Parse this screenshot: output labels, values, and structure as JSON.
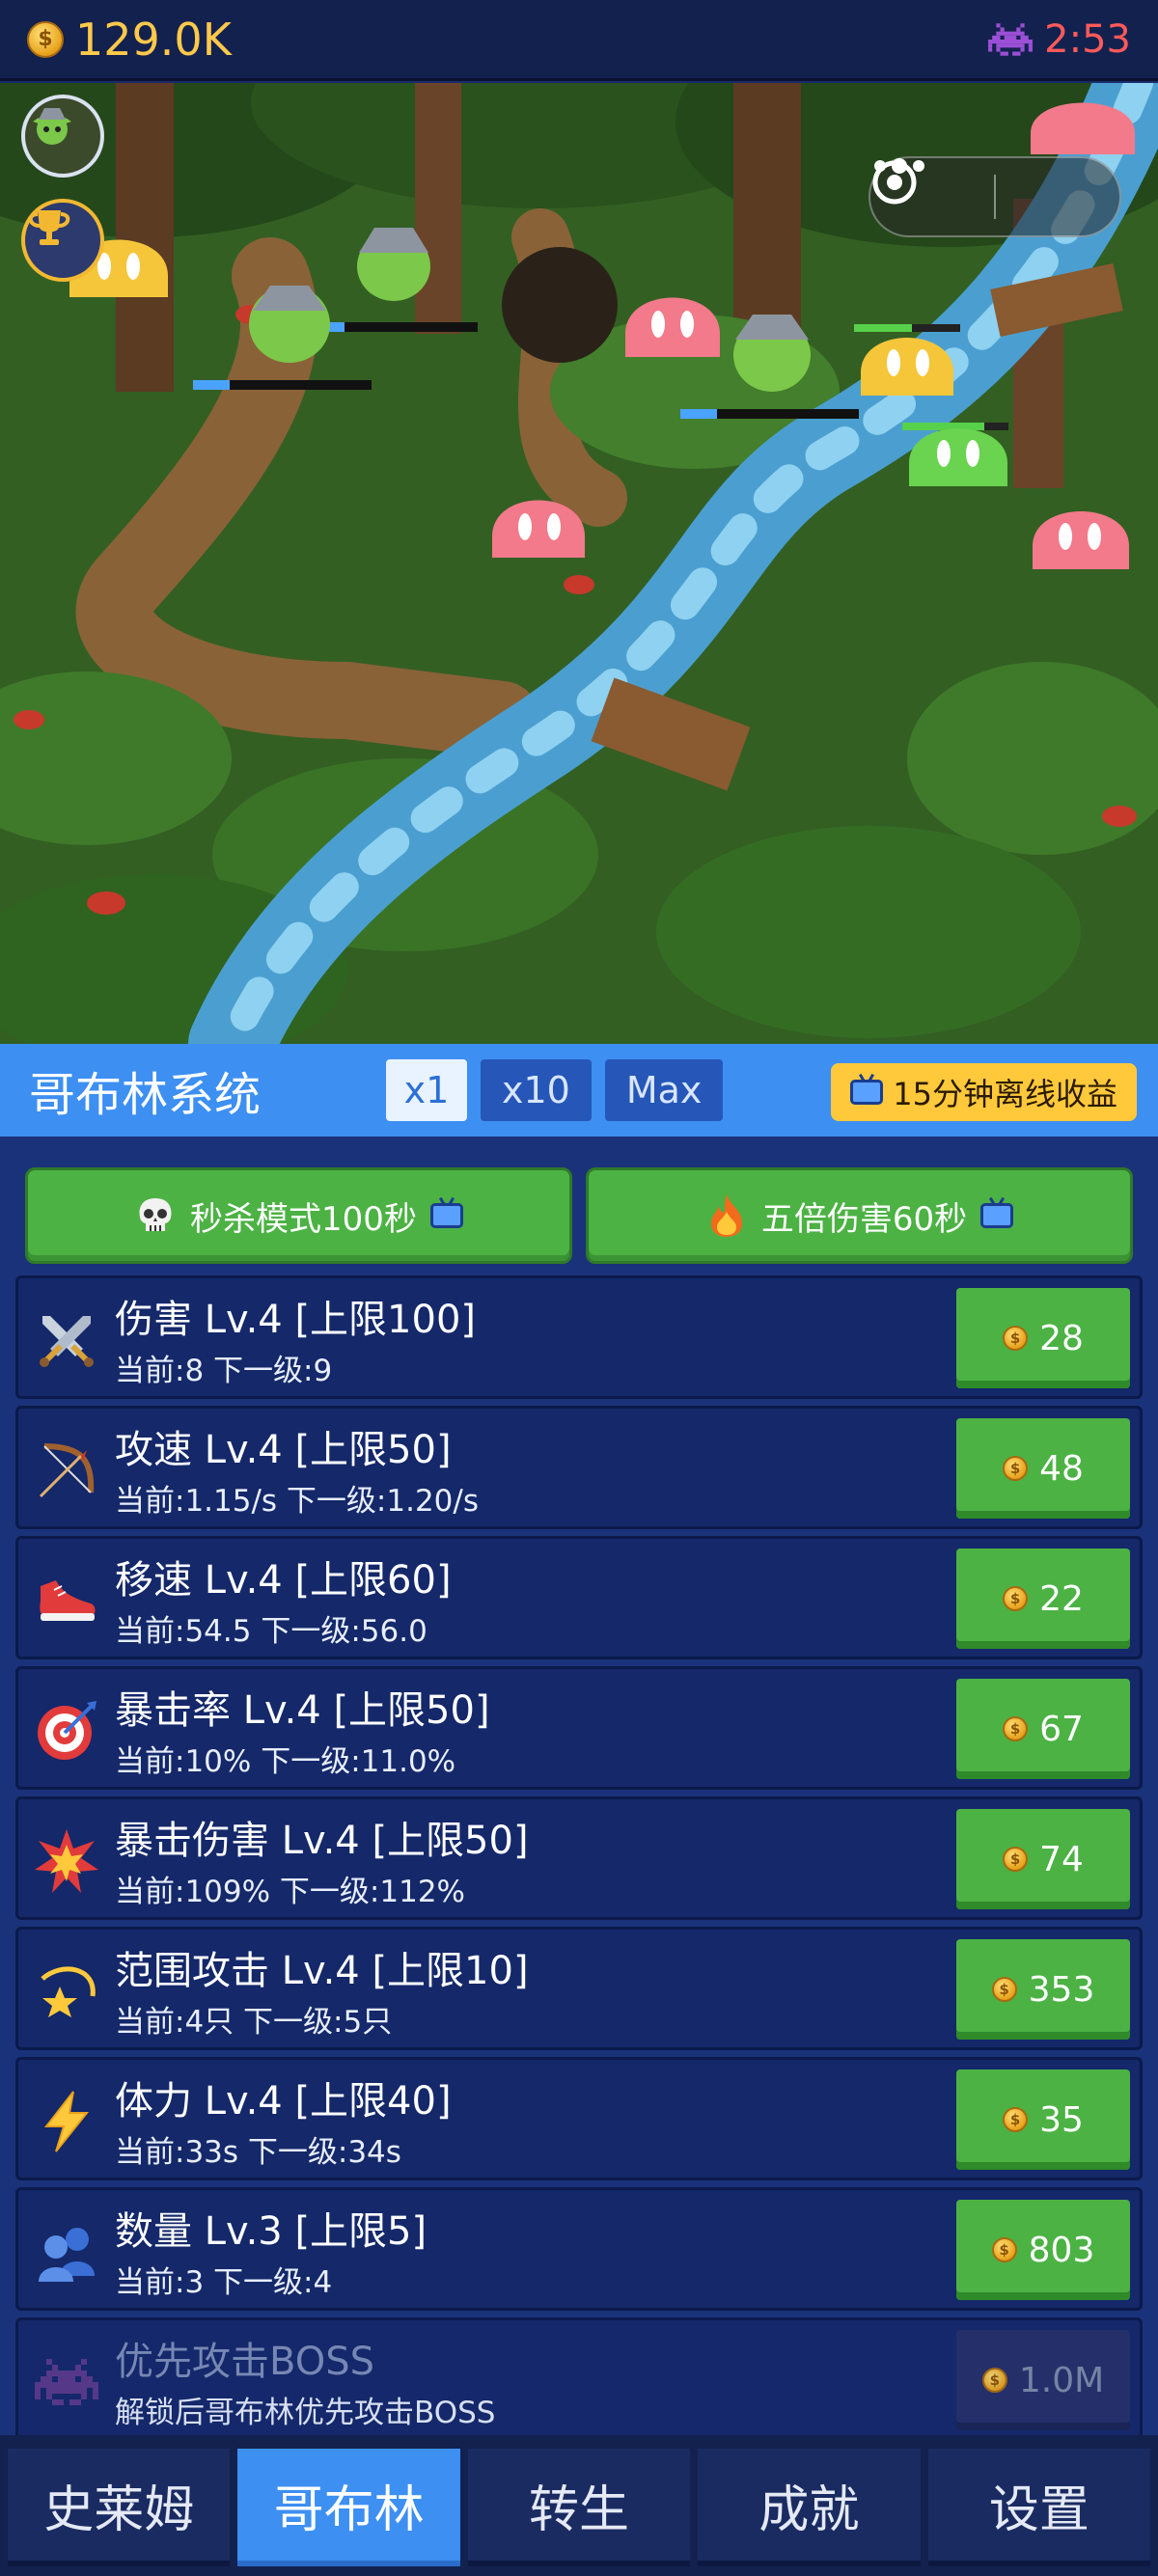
{
  "topbar": {
    "coin_symbol": "$",
    "gold": "129.0K",
    "timer": "2:53",
    "timer_color": "#ff5a5a",
    "gold_color": "#ffc94a"
  },
  "scene": {
    "capsule_icons": [
      "more-dots-icon",
      "target-circle-icon"
    ]
  },
  "system": {
    "title": "哥布林系统",
    "multipliers": [
      "x1",
      "x10",
      "Max"
    ],
    "active_multiplier": "x1",
    "offline_label": "15分钟离线收益"
  },
  "boosts": [
    {
      "label": "秒杀模式100秒",
      "icon": "skull-icon"
    },
    {
      "label": "五倍伤害60秒",
      "icon": "fire-icon"
    }
  ],
  "upgrades": [
    {
      "icon": "sword-icon",
      "title": "伤害 Lv.4 [上限100]",
      "sub": "当前:8   下一级:9",
      "cost": "28"
    },
    {
      "icon": "bow-icon",
      "title": "攻速 Lv.4 [上限50]",
      "sub": "当前:1.15/s   下一级:1.20/s",
      "cost": "48"
    },
    {
      "icon": "shoe-icon",
      "title": "移速 Lv.4 [上限60]",
      "sub": "当前:54.5   下一级:56.0",
      "cost": "22"
    },
    {
      "icon": "target-icon",
      "title": "暴击率 Lv.4 [上限50]",
      "sub": "当前:10%   下一级:11.0%",
      "cost": "67"
    },
    {
      "icon": "burst-icon",
      "title": "暴击伤害 Lv.4 [上限50]",
      "sub": "当前:109%   下一级:112%",
      "cost": "74"
    },
    {
      "icon": "star-swoosh-icon",
      "title": "范围攻击 Lv.4 [上限10]",
      "sub": "当前:4只   下一级:5只",
      "cost": "353"
    },
    {
      "icon": "lightning-icon",
      "title": "体力 Lv.4 [上限40]",
      "sub": "当前:33s   下一级:34s",
      "cost": "35"
    },
    {
      "icon": "people-icon",
      "title": "数量 Lv.3 [上限5]",
      "sub": "当前:3   下一级:4",
      "cost": "803"
    },
    {
      "icon": "space-invader-icon",
      "title": "优先攻击BOSS",
      "sub": "解锁后哥布林优先攻击BOSS",
      "cost": "1.0M",
      "locked": true
    }
  ],
  "tabs": [
    {
      "label": "史莱姆"
    },
    {
      "label": "哥布林",
      "active": true
    },
    {
      "label": "转生"
    },
    {
      "label": "成就"
    },
    {
      "label": "设置"
    }
  ]
}
